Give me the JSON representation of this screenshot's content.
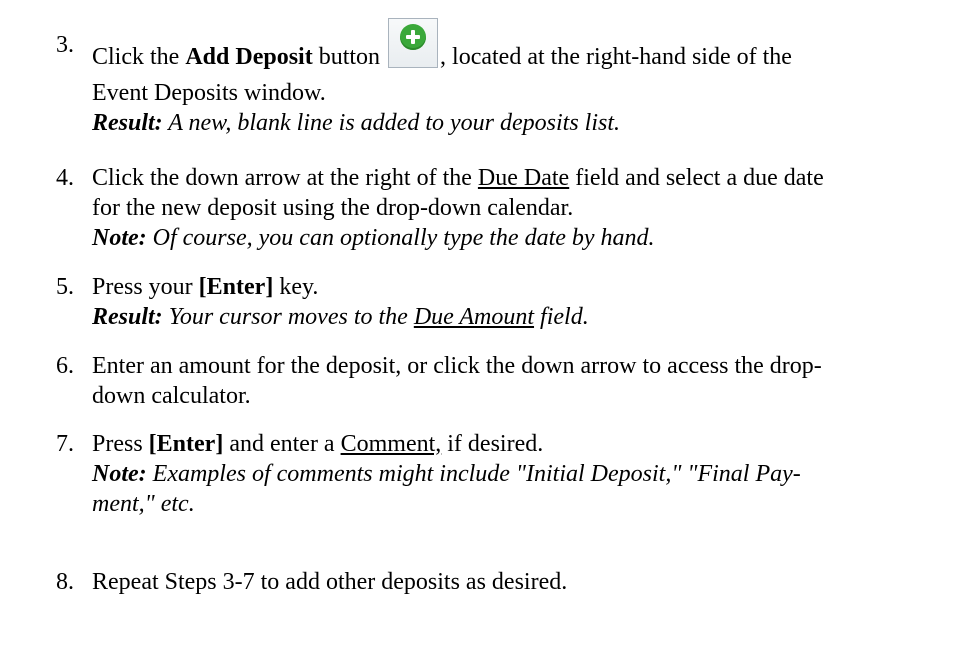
{
  "steps": [
    {
      "number": "3.",
      "line1_before": "Click the ",
      "line1_bold": "Add Deposit",
      "line1_mid": " button",
      "icon": "add-circle-green-icon",
      "line1_after": ", located at the right-hand side of the",
      "line2": "Event Deposits window.",
      "result_label": "Result:",
      "result_text": " A new, blank line is added to your deposits list."
    },
    {
      "number": "4.",
      "line1_before": "Click the down arrow at the right of the ",
      "line1_underline": "Due Date",
      "line1_after": " field and select a due date",
      "line2": "for the new deposit using the drop-down calendar.",
      "note_label": "Note:",
      "note_text": " Of course, you can optionally type the date by hand."
    },
    {
      "number": "5.",
      "line1_before": "Press your ",
      "line1_bold": "[Enter]",
      "line1_after": " key.",
      "result_label": "Result:",
      "result_before": " Your cursor moves to the ",
      "result_underline": "Due Amount",
      "result_after": " field."
    },
    {
      "number": "6.",
      "line1": "Enter an amount for the deposit, or click the down arrow to access the drop-",
      "line2": "down calculator."
    },
    {
      "number": "7.",
      "line1_before": "Press ",
      "line1_bold": "[Enter]",
      "line1_mid": " and enter a ",
      "line1_underline": "Comment,",
      "line1_after": " if desired.",
      "note_label": "Note:",
      "note_line1": " Examples of comments might include \"Initial Deposit,\" \"Final Pay-",
      "note_line2": "ment,\" etc."
    },
    {
      "number": "8.",
      "line1": "Repeat Steps 3-7 to add other deposits as desired."
    }
  ]
}
